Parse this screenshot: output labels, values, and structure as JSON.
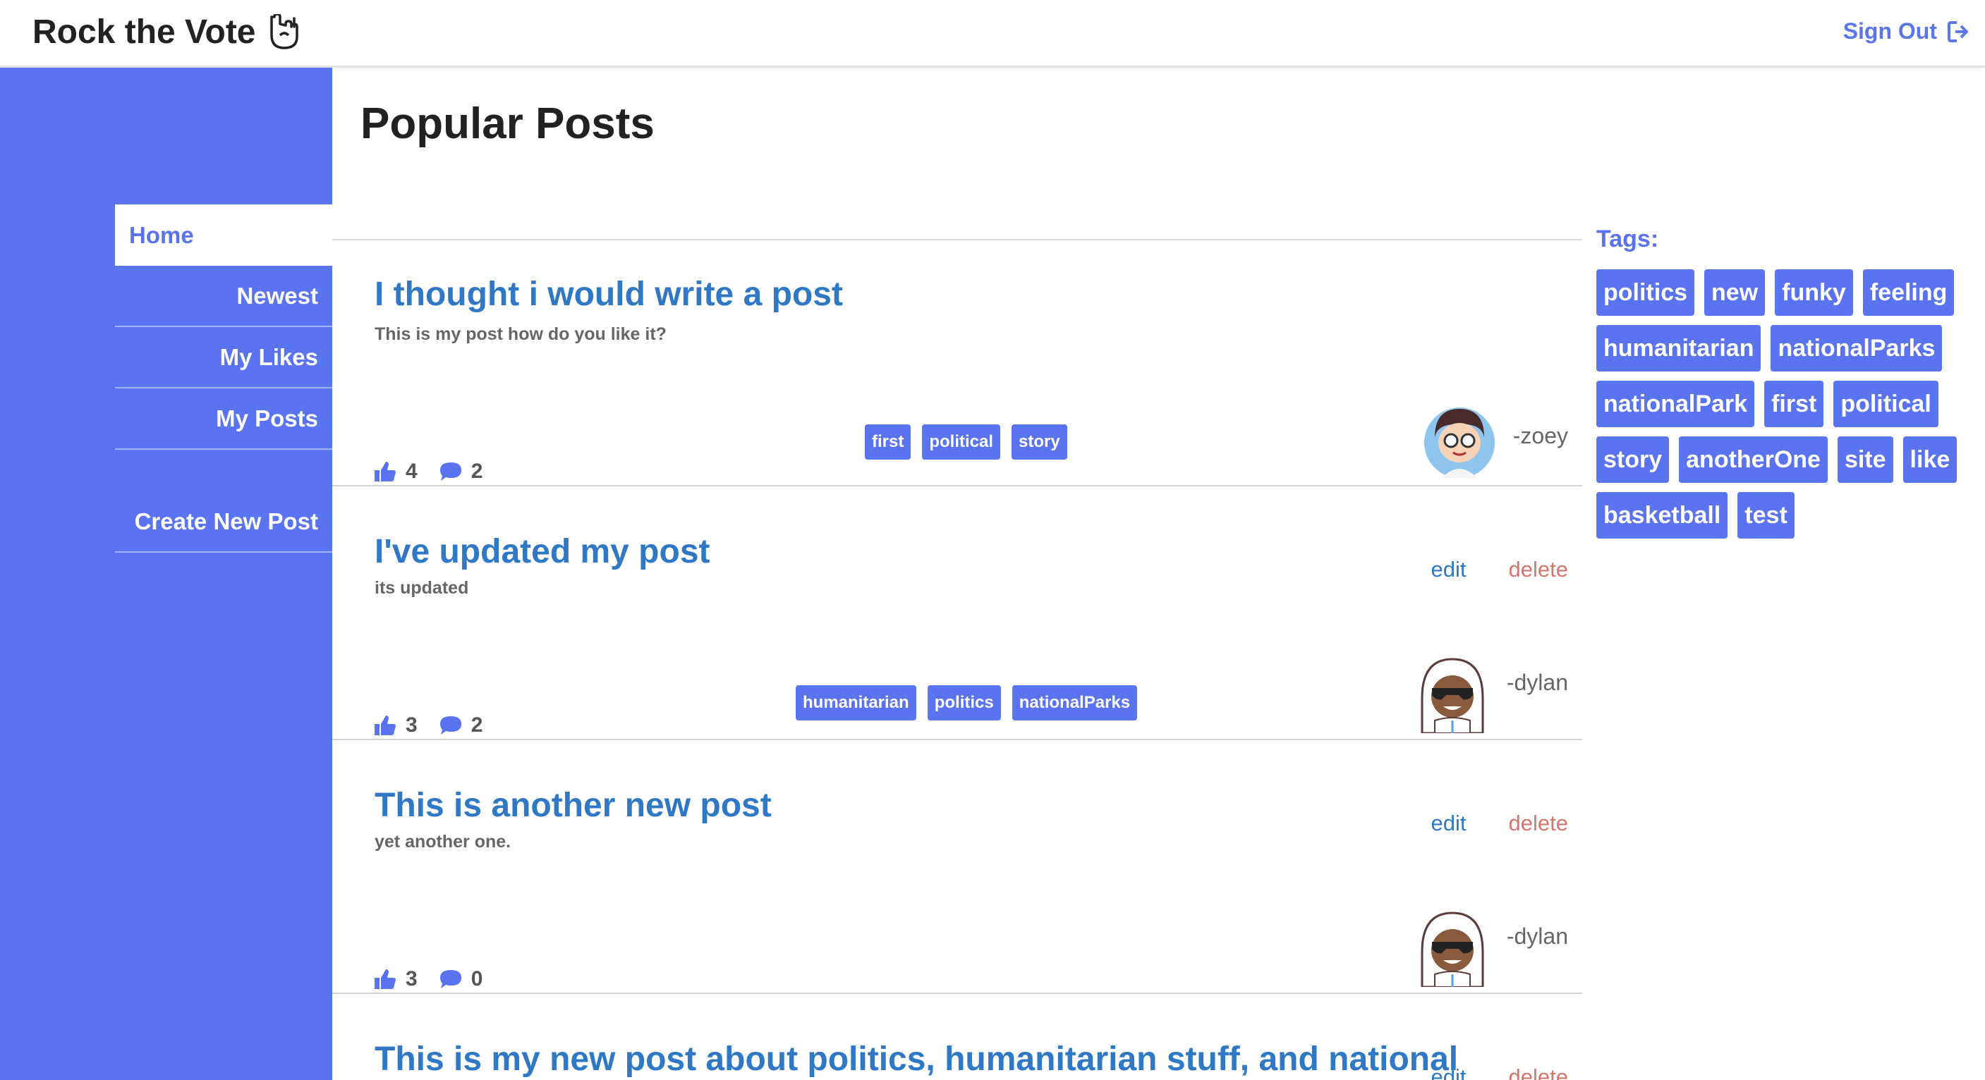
{
  "header": {
    "brand": "Rock the Vote",
    "sign_out": "Sign Out"
  },
  "sidebar": {
    "items": [
      {
        "label": "Home",
        "active": true
      },
      {
        "label": "Newest"
      },
      {
        "label": "My Likes"
      },
      {
        "label": "My Posts"
      },
      {
        "label": "Create New Post"
      }
    ]
  },
  "main": {
    "title": "Popular Posts"
  },
  "actions": {
    "edit": "edit",
    "delete": "delete"
  },
  "posts": [
    {
      "title": "I thought i would write a post",
      "description": "This is my post how do you like it?",
      "likes": "4",
      "comments": "2",
      "tags": [
        "first",
        "political",
        "story"
      ],
      "author": "-zoey"
    },
    {
      "title": "I've updated my post",
      "description": "its updated",
      "likes": "3",
      "comments": "2",
      "tags": [
        "humanitarian",
        "politics",
        "nationalParks"
      ],
      "author": "-dylan"
    },
    {
      "title": "This is another new post",
      "description": "yet another one.",
      "likes": "3",
      "comments": "0",
      "tags": [],
      "author": "-dylan"
    },
    {
      "title": "This is my new post about politics, humanitarian stuff, and national"
    }
  ],
  "tags_panel": {
    "heading": "Tags:",
    "rows": [
      [
        "politics",
        "new",
        "funky",
        "feeling"
      ],
      [
        "humanitarian",
        "nationalParks"
      ],
      [
        "nationalPark",
        "first",
        "political"
      ],
      [
        "story",
        "anotherOne",
        "site",
        "like"
      ],
      [
        "basketball",
        "test"
      ]
    ]
  },
  "colors": {
    "accent": "#5a73f0",
    "link": "#2f78c6",
    "delete": "#d2766f"
  }
}
